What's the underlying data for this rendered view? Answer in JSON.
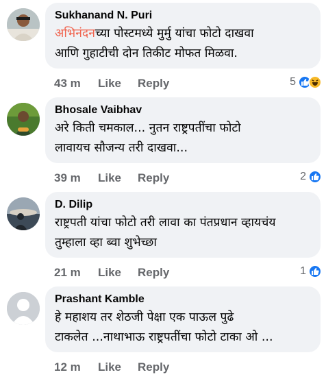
{
  "comments": [
    {
      "author": "Sukhanand N. Puri",
      "mention": "अभिनंदन",
      "text": "च्या पोस्टमध्ये मुर्मु यांचा फोटो दाखवा\nआणि गुहाटीची दोन तिकीट मोफत मिळवा.",
      "time": "43 m",
      "like": "Like",
      "reply": "Reply",
      "reaction_count": "5",
      "reactions": [
        "like-icon",
        "haha-icon"
      ]
    },
    {
      "author": "Bhosale Vaibhav",
      "mention": "",
      "text": "अरे किती चमकाल... नुतन राष्ट्रपतींचा फोटो\nलावायच सौजन्य तरी दाखवा...",
      "time": "39 m",
      "like": "Like",
      "reply": "Reply",
      "reaction_count": "2",
      "reactions": [
        "like-icon"
      ]
    },
    {
      "author": "D. Dilip",
      "mention": "",
      "text": "राष्ट्रपती यांचा फोटो तरी लावा का पंतप्रधान व्हायचंय\nतुम्हाला व्हा ब्वा शुभेच्छा",
      "time": "21 m",
      "like": "Like",
      "reply": "Reply",
      "reaction_count": "1",
      "reactions": [
        "like-icon"
      ]
    },
    {
      "author": "Prashant Kamble",
      "mention": "",
      "text": "हे महाशय तर शेठजी पेक्षा एक पाऊल पुढे\nटाकलेत ...नाथाभाऊ राष्ट्रपतींचा फोटो टाका ओ ...",
      "time": "12 m",
      "like": "Like",
      "reply": "Reply",
      "reaction_count": "",
      "reactions": []
    }
  ],
  "colors": {
    "bubble": "#f0f2f5",
    "meta": "#65676b",
    "mention": "#f0644f",
    "like_blue": "#1877f2",
    "haha_yellow": "#f7b928"
  }
}
